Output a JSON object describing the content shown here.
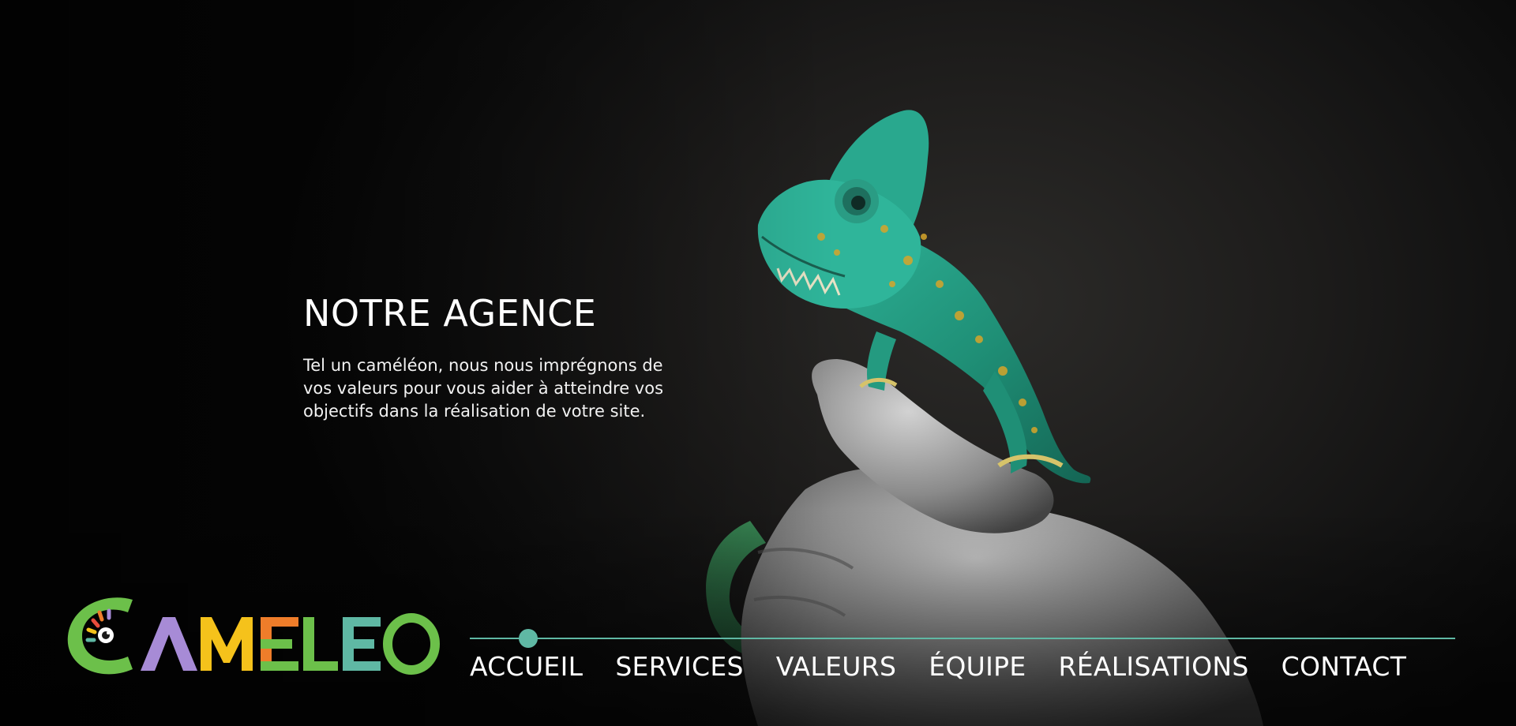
{
  "hero": {
    "title": "NOTRE AGENCE",
    "body": "Tel un caméléon, nous nous imprégnons de vos valeurs pour vous aider à atteindre vos objectifs dans la réalisation de votre site."
  },
  "logo": {
    "text": "CAMELEO",
    "colors": {
      "C": "#6cc04a",
      "A": "#a78bd6",
      "M": "#f5c21b",
      "E1": "#ef7d2a",
      "L": "#6cc04a",
      "E2": "#5fb8a4",
      "O": "#6cc04a"
    }
  },
  "nav": {
    "active_index": 0,
    "accent_color": "#5fb8a4",
    "items": [
      {
        "label": "ACCUEIL"
      },
      {
        "label": "SERVICES"
      },
      {
        "label": "VALEURS"
      },
      {
        "label": "ÉQUIPE"
      },
      {
        "label": "RÉALISATIONS"
      },
      {
        "label": "CONTACT"
      }
    ]
  }
}
